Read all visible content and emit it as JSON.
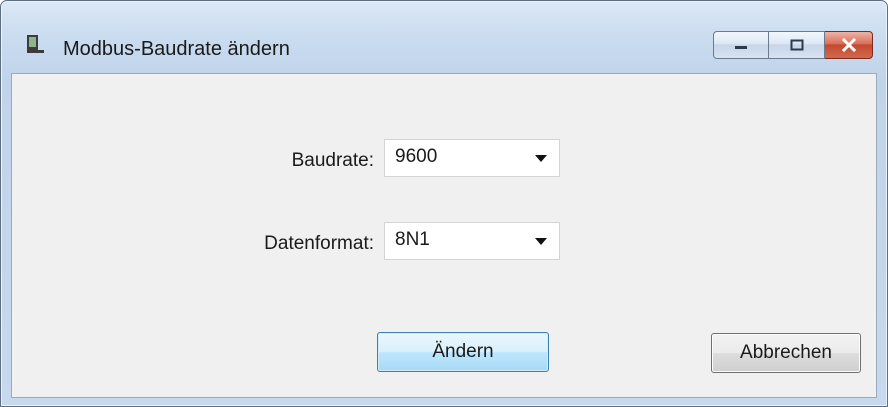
{
  "window": {
    "title": "Modbus-Baudrate ändern"
  },
  "form": {
    "baudrate_label": "Baudrate:",
    "baudrate_value": "9600",
    "format_label": "Datenformat:",
    "format_value": "8N1"
  },
  "buttons": {
    "apply_label": "Ändern",
    "cancel_label": "Abbrechen"
  },
  "colors": {
    "close_button": "#c24a2f",
    "primary_button_border": "#3c7fb1"
  },
  "icons": {
    "app": "serial-device-icon",
    "minimize": "minimize-icon",
    "maximize": "maximize-icon",
    "close": "close-icon",
    "dropdown": "chevron-down-icon"
  }
}
